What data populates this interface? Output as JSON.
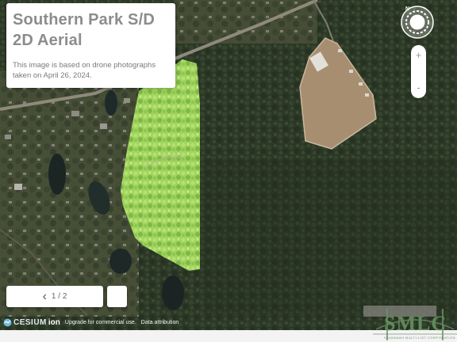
{
  "info": {
    "title_line1": "Southern Park S/D",
    "title_line2": "2D Aerial",
    "description": "This image is based on drone photographs taken on April 26, 2024."
  },
  "compass": {
    "north_label": "N"
  },
  "zoom": {
    "in_label": "+",
    "out_label": "-"
  },
  "pager": {
    "prev_icon": "‹",
    "count": "1 / 2"
  },
  "attribution": {
    "cesium": "CESIUM",
    "ion": "ion",
    "upgrade": "Upgrade for commercial use.",
    "data": "Data attribution"
  },
  "logo": {
    "word": "SMLC",
    "subtitle": "SAVANNAH MULTI-LIST CORPORATION"
  },
  "colors": {
    "forest": "#2f3b2a",
    "parcel": "#9bd25a",
    "clearing": "#a48a6d",
    "water": "#1f2a2a",
    "road": "#9a9285"
  }
}
